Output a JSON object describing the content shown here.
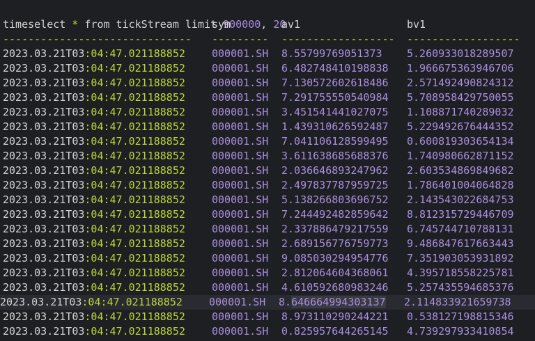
{
  "query": {
    "prefix": "select ",
    "star": "*",
    "middle": " from tickStream limit ",
    "n1": "900000",
    "comma": ", ",
    "n2": "20"
  },
  "columns": [
    "time",
    "sym",
    "av1",
    "bv1"
  ],
  "separators": [
    "------------------------------",
    "---------",
    "------------------",
    "------------------"
  ],
  "rows": [
    {
      "date": "2023.03.21T03",
      "clock": ":04:47.021188852",
      "sym": "000001.SH",
      "av1": "8.55799769051373",
      "bv1": "5.260933018289507"
    },
    {
      "date": "2023.03.21T03",
      "clock": ":04:47.021188852",
      "sym": "000001.SH",
      "av1": "6.482748410198838",
      "bv1": "1.966675363946706"
    },
    {
      "date": "2023.03.21T03",
      "clock": ":04:47.021188852",
      "sym": "000001.SH",
      "av1": "7.130572602618486",
      "bv1": "2.571492490824312"
    },
    {
      "date": "2023.03.21T03",
      "clock": ":04:47.021188852",
      "sym": "000001.SH",
      "av1": "7.291755550540984",
      "bv1": "5.708958429750055"
    },
    {
      "date": "2023.03.21T03",
      "clock": ":04:47.021188852",
      "sym": "000001.SH",
      "av1": "3.451541441027075",
      "bv1": "1.108871740289032"
    },
    {
      "date": "2023.03.21T03",
      "clock": ":04:47.021188852",
      "sym": "000001.SH",
      "av1": "1.439310626592487",
      "bv1": "5.229492676444352"
    },
    {
      "date": "2023.03.21T03",
      "clock": ":04:47.021188852",
      "sym": "000001.SH",
      "av1": "7.041106128599495",
      "bv1": "0.600819303654134"
    },
    {
      "date": "2023.03.21T03",
      "clock": ":04:47.021188852",
      "sym": "000001.SH",
      "av1": "3.611638685688376",
      "bv1": "1.740980662871152"
    },
    {
      "date": "2023.03.21T03",
      "clock": ":04:47.021188852",
      "sym": "000001.SH",
      "av1": "2.036646893247962",
      "bv1": "2.603534869849682"
    },
    {
      "date": "2023.03.21T03",
      "clock": ":04:47.021188852",
      "sym": "000001.SH",
      "av1": "2.497837787959725",
      "bv1": "1.786401004064828"
    },
    {
      "date": "2023.03.21T03",
      "clock": ":04:47.021188852",
      "sym": "000001.SH",
      "av1": "5.138266803696752",
      "bv1": "2.143543022684753"
    },
    {
      "date": "2023.03.21T03",
      "clock": ":04:47.021188852",
      "sym": "000001.SH",
      "av1": "7.244492482859642",
      "bv1": "8.812315729446709"
    },
    {
      "date": "2023.03.21T03",
      "clock": ":04:47.021188852",
      "sym": "000001.SH",
      "av1": "2.337886479217559",
      "bv1": "6.745744710788131"
    },
    {
      "date": "2023.03.21T03",
      "clock": ":04:47.021188852",
      "sym": "000001.SH",
      "av1": "2.689156776759773",
      "bv1": "9.486847617663443"
    },
    {
      "date": "2023.03.21T03",
      "clock": ":04:47.021188852",
      "sym": "000001.SH",
      "av1": "9.085030294954776",
      "bv1": "7.351903053931892"
    },
    {
      "date": "2023.03.21T03",
      "clock": ":04:47.021188852",
      "sym": "000001.SH",
      "av1": "2.812064604368061",
      "bv1": "4.395718558225781"
    },
    {
      "date": "2023.03.21T03",
      "clock": ":04:47.021188852",
      "sym": "000001.SH",
      "av1": "4.610592680983246",
      "bv1": "5.257435594685376"
    },
    {
      "date": "2023.03.21T03",
      "clock": ":04:47.021188852",
      "sym": "000001.SH",
      "av1_pre": "8.",
      "av1_sel": "646664994303137",
      "bv1": "2.114833921659738",
      "highlight": true
    },
    {
      "date": "2023.03.21T03",
      "clock": ":04:47.021188852",
      "sym": "000001.SH",
      "av1": "8.973110290244221",
      "bv1": "0.538127198815346"
    },
    {
      "date": "2023.03.21T03",
      "clock": ":04:47.021188852",
      "sym": "000001.SH",
      "av1": "0.825957644265145",
      "bv1": "4.739297933410854"
    }
  ]
}
